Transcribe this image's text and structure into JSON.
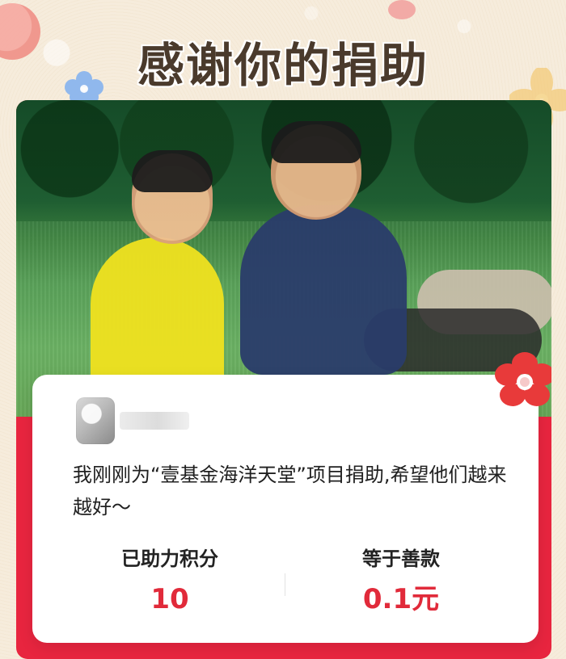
{
  "title": "感谢你的捐助",
  "card": {
    "message": "我刚刚为“壹基金海洋天堂”项目捐助,希望他们越来越好～",
    "stats": {
      "left": {
        "label": "已助力积分",
        "value": "10"
      },
      "right": {
        "label": "等于善款",
        "value": "0.1元"
      }
    }
  },
  "colors": {
    "frame_red": "#e8253f",
    "accent_red": "#e12a3a",
    "title_brown": "#4a3a2c",
    "background": "#f6ecdc"
  }
}
